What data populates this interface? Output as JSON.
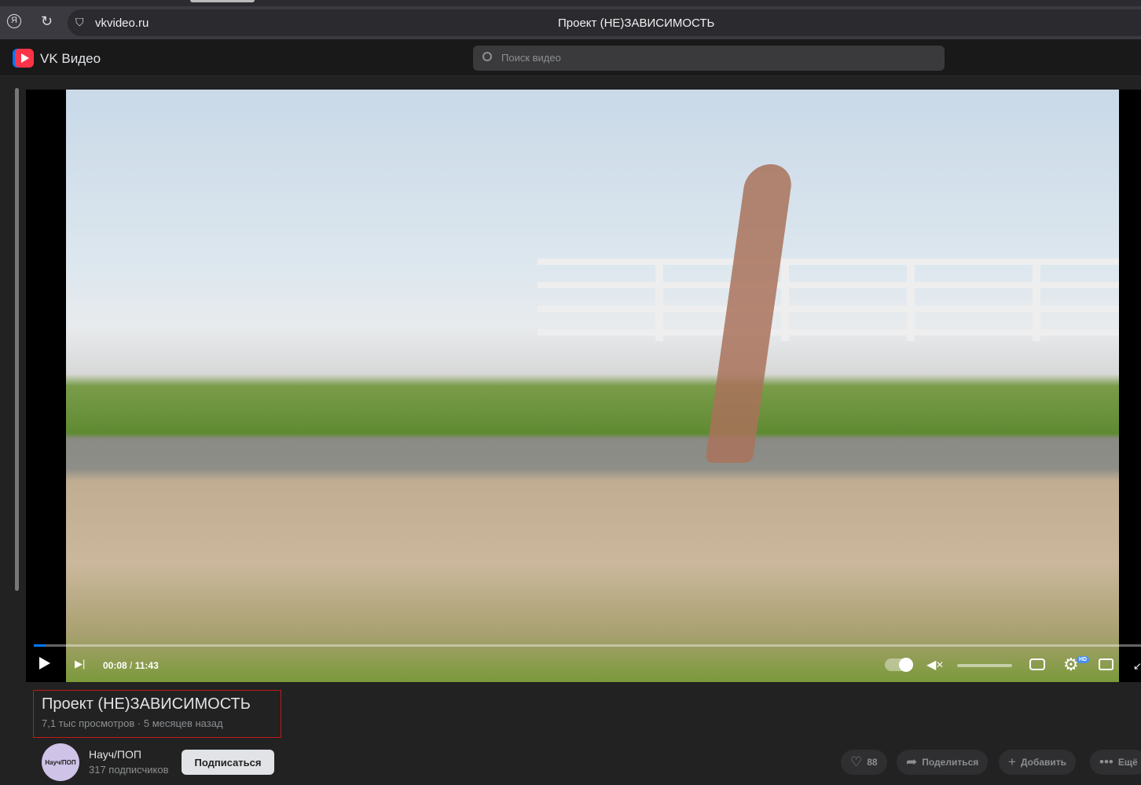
{
  "browser": {
    "url": "vkvideo.ru",
    "page_title": "Проект (НЕ)ЗАВИСИМОСТЬ"
  },
  "header": {
    "brand": "VK Видео",
    "search_placeholder": "Поиск видео"
  },
  "player": {
    "current_time": "00:08",
    "duration": "11:43",
    "progress_percent": 1.1,
    "quality_badge": "HD"
  },
  "video": {
    "title": "Проект (НЕ)ЗАВИСИМОСТЬ",
    "views": "7,1 тыс просмотров",
    "separator": "·",
    "published": "5 месяцев назад"
  },
  "channel": {
    "avatar_text": "Науч/ПОП",
    "name": "Науч/ПОП",
    "subscribers": "317 подписчиков",
    "subscribe_label": "Подписаться"
  },
  "actions": {
    "likes": "88",
    "share": "Поделиться",
    "add": "Добавить",
    "more": "Ещё"
  },
  "colors": {
    "accent": "#0077ff",
    "logo": "#ff3347",
    "highlight_border": "#c21a1a"
  }
}
